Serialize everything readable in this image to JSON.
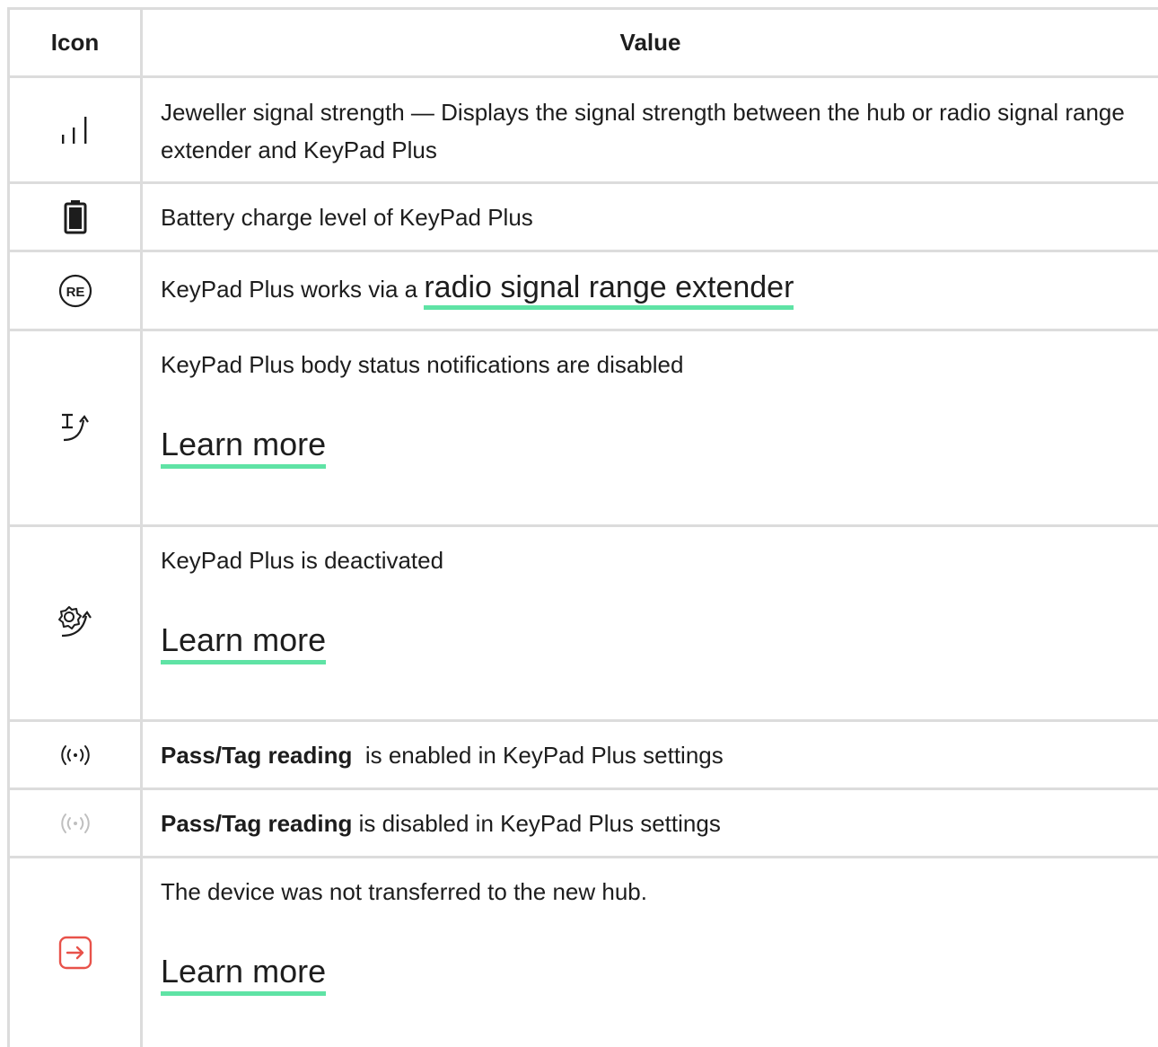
{
  "header": {
    "icon_col": "Icon",
    "value_col": "Value"
  },
  "rows": [
    {
      "icon": "signal-strength-icon",
      "text": "Jeweller signal strength — Displays the signal strength between the hub or radio signal range extender and KeyPad Plus"
    },
    {
      "icon": "battery-icon",
      "text": "Battery charge level of KeyPad Plus"
    },
    {
      "icon": "re-icon",
      "icon_label": "RE",
      "text": "KeyPad Plus works via a ",
      "link": "radio signal range extender"
    },
    {
      "icon": "body-notification-off-icon",
      "text": "KeyPad Plus body status notifications are disabled",
      "link": "Learn more"
    },
    {
      "icon": "deactivated-gear-icon",
      "text": "KeyPad Plus is deactivated",
      "link": "Learn more"
    },
    {
      "icon": "tag-reading-enabled-icon",
      "bold": "Pass/Tag reading",
      "text": "  is enabled in KeyPad Plus settings"
    },
    {
      "icon": "tag-reading-disabled-icon",
      "bold": "Pass/Tag reading",
      "text": " is disabled in KeyPad Plus settings"
    },
    {
      "icon": "transfer-failed-icon",
      "text": "The device was not transferred to the new hub.",
      "link": "Learn more"
    }
  ],
  "colors": {
    "link_underline": "#5fe3a5",
    "alert": "#e8524a",
    "grid": "#dcdcdc"
  }
}
